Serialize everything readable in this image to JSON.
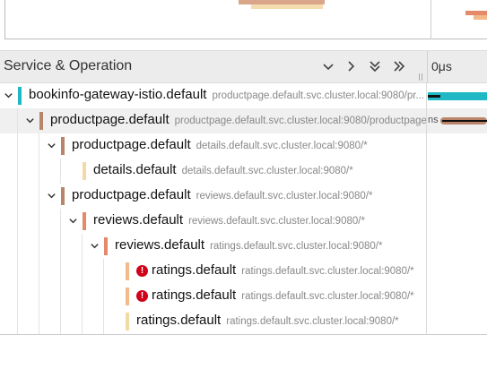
{
  "header": {
    "title": "Service & Operation",
    "controls": [
      {
        "name": "collapse-one-button",
        "icon": "chevron-down-icon"
      },
      {
        "name": "expand-one-button",
        "icon": "chevron-right-icon"
      },
      {
        "name": "expand-all-button",
        "icon": "double-chevron-down-icon"
      },
      {
        "name": "collapse-all-button",
        "icon": "double-chevron-right-icon"
      }
    ],
    "time_tick": "0μs"
  },
  "colors": {
    "teal": "#1fb8c4",
    "brown": "#b9856a",
    "tan": "#f3d9a6",
    "salmon": "#e5896b",
    "peach": "#f2b98a",
    "error": "#d0021b"
  },
  "rows": [
    {
      "service": "bookinfo-gateway-istio.default",
      "operation": "productpage.default.svc.cluster.local:9080/pr...",
      "color": "#1fb8c4",
      "expanded": true,
      "error": false
    },
    {
      "service": "productpage.default",
      "operation": "productpage.default.svc.cluster.local:9080/productpage",
      "color": "#b9856a",
      "expanded": true,
      "error": false,
      "span_label": "ns"
    },
    {
      "service": "productpage.default",
      "operation": "details.default.svc.cluster.local:9080/*",
      "color": "#b9856a",
      "expanded": true,
      "error": false
    },
    {
      "service": "details.default",
      "operation": "details.default.svc.cluster.local:9080/*",
      "color": "#f3d9a6",
      "expanded": null,
      "error": false
    },
    {
      "service": "productpage.default",
      "operation": "reviews.default.svc.cluster.local:9080/*",
      "color": "#b9856a",
      "expanded": true,
      "error": false
    },
    {
      "service": "reviews.default",
      "operation": "reviews.default.svc.cluster.local:9080/*",
      "color": "#e5896b",
      "expanded": true,
      "error": false
    },
    {
      "service": "reviews.default",
      "operation": "ratings.default.svc.cluster.local:9080/*",
      "color": "#e5896b",
      "expanded": true,
      "error": false
    },
    {
      "service": "ratings.default",
      "operation": "ratings.default.svc.cluster.local:9080/*",
      "color": "#f2b98a",
      "expanded": null,
      "error": true
    },
    {
      "service": "ratings.default",
      "operation": "ratings.default.svc.cluster.local:9080/*",
      "color": "#f2b98a",
      "expanded": null,
      "error": true
    },
    {
      "service": "ratings.default",
      "operation": "ratings.default.svc.cluster.local:9080/*",
      "color": "#f3d9a6",
      "expanded": null,
      "error": false
    }
  ]
}
